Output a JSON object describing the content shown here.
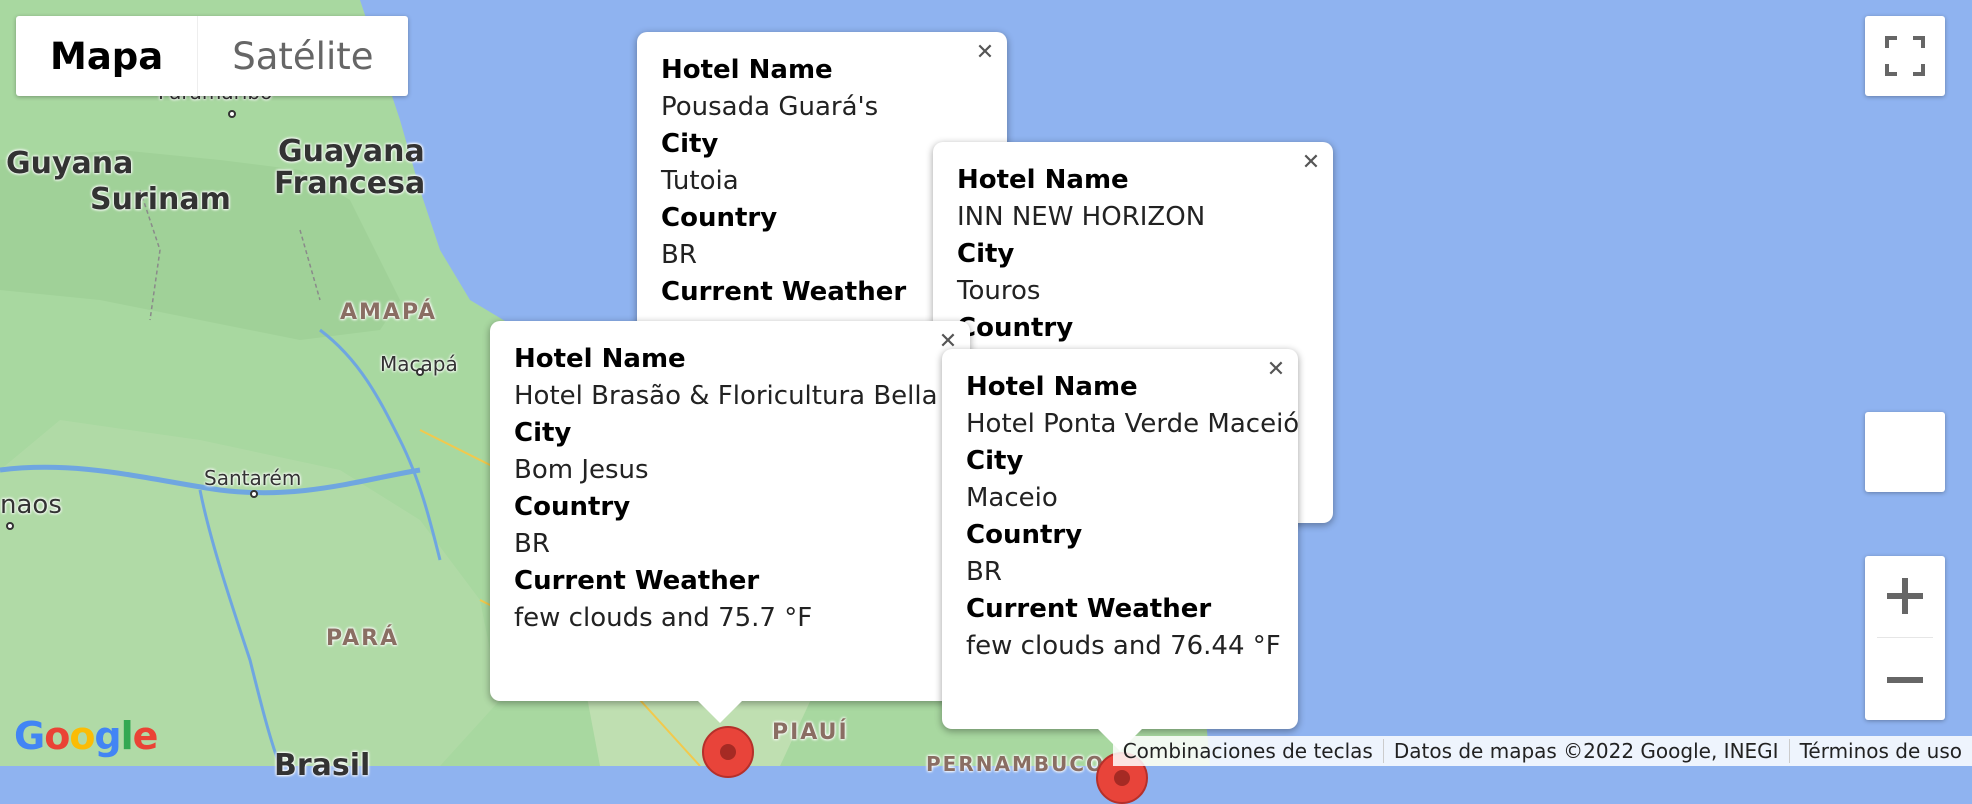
{
  "map_type": {
    "map_label": "Mapa",
    "satellite_label": "Satélite"
  },
  "map_labels": {
    "paramaribo": "Paramaribo",
    "guyana": "Guyana",
    "surinam": "Surinam",
    "guayana_francesa_1": "Guayana",
    "guayana_francesa_2": "Francesa",
    "amapa": "AMAPÁ",
    "macapa": "Macapá",
    "santarem": "Santarém",
    "manaos": "naos",
    "para": "PARÁ",
    "piaui": "PIAUÍ",
    "pernambuco": "PERNAMBUCO",
    "brasil": "Brasil"
  },
  "info_windows": [
    {
      "hotel_name_label": "Hotel Name",
      "hotel_name": "Pousada Guará's",
      "city_label": "City",
      "city": "Tutoia",
      "country_label": "Country",
      "country": "BR",
      "weather_label": "Current Weather",
      "weather": ""
    },
    {
      "hotel_name_label": "Hotel Name",
      "hotel_name": "INN NEW HORIZON",
      "city_label": "City",
      "city": "Touros",
      "country_label": "Country",
      "country": "",
      "weather_label": "",
      "weather": ""
    },
    {
      "hotel_name_label": "Hotel Name",
      "hotel_name": "Hotel Brasão & Floricultura Bella Flor",
      "city_label": "City",
      "city": "Bom Jesus",
      "country_label": "Country",
      "country": "BR",
      "weather_label": "Current Weather",
      "weather": "few clouds and 75.7 °F"
    },
    {
      "hotel_name_label": "Hotel Name",
      "hotel_name": "Hotel Ponta Verde Maceió",
      "city_label": "City",
      "city": "Maceio",
      "country_label": "Country",
      "country": "BR",
      "weather_label": "Current Weather",
      "weather": "few clouds and 76.44 °F"
    }
  ],
  "google_logo": "Google",
  "attribution": {
    "shortcuts": "Combinaciones de teclas",
    "data": "Datos de mapas ©2022 Google, INEGI",
    "terms": "Términos de uso"
  },
  "icons": {
    "fullscreen": "fullscreen-icon",
    "zoom_in": "plus-icon",
    "zoom_out": "minus-icon",
    "close": "close-icon"
  },
  "colors": {
    "water": "#8fb3f0",
    "land": "#a8d8a0",
    "marker": "#e8443a"
  }
}
